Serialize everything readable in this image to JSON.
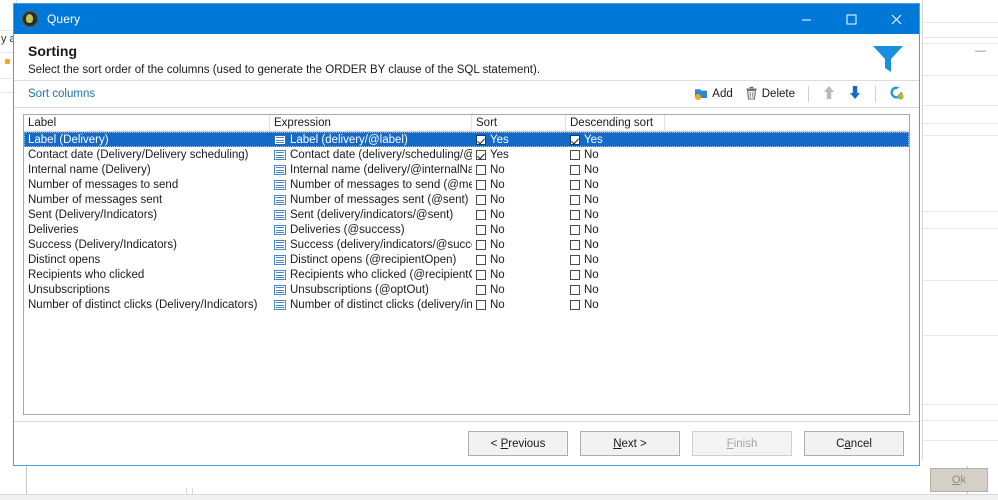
{
  "window": {
    "title": "Query",
    "icon": "query-app-icon",
    "controls": {
      "minimize": "minimize-icon",
      "maximize": "maximize-icon",
      "close": "close-icon"
    }
  },
  "header": {
    "title": "Sorting",
    "subtitle": "Select the sort order of the columns (used to generate the ORDER BY clause of the SQL statement).",
    "icon": "funnel-filter-icon",
    "accent_color": "#1a8fe0"
  },
  "toolbar": {
    "section_label": "Sort columns",
    "add_label": "Add",
    "delete_label": "Delete",
    "move_up_icon": "arrow-up-icon",
    "move_down_icon": "arrow-down-icon",
    "refresh_icon": "refresh-icon"
  },
  "grid": {
    "columns": [
      "Label",
      "Expression",
      "Sort",
      "Descending sort",
      ""
    ],
    "rows": [
      {
        "label": "Label (Delivery)",
        "expression": "Label (delivery/@label)",
        "sort": "Yes",
        "sort_checked": true,
        "descending": "Yes",
        "descending_checked": true,
        "selected": true,
        "warning": false
      },
      {
        "label": "Contact date (Delivery/Delivery scheduling)",
        "expression": "Contact date (delivery/scheduling/@co...",
        "sort": "Yes",
        "sort_checked": true,
        "descending": "No",
        "descending_checked": false,
        "selected": false,
        "warning": false
      },
      {
        "label": "Internal name (Delivery)",
        "expression": "Internal name (delivery/@internalNa...",
        "sort": "No",
        "sort_checked": false,
        "descending": "No",
        "descending_checked": false,
        "selected": false,
        "warning": true
      },
      {
        "label": "Number of messages to send",
        "expression": "Number of messages to send (@mess...",
        "sort": "No",
        "sort_checked": false,
        "descending": "No",
        "descending_checked": false,
        "selected": false,
        "warning": false
      },
      {
        "label": "Number of messages sent",
        "expression": "Number of messages sent (@sent)",
        "sort": "No",
        "sort_checked": false,
        "descending": "No",
        "descending_checked": false,
        "selected": false,
        "warning": false
      },
      {
        "label": "Sent (Delivery/Indicators)",
        "expression": "Sent (delivery/indicators/@sent)",
        "sort": "No",
        "sort_checked": false,
        "descending": "No",
        "descending_checked": false,
        "selected": false,
        "warning": false
      },
      {
        "label": "Deliveries",
        "expression": "Deliveries (@success)",
        "sort": "No",
        "sort_checked": false,
        "descending": "No",
        "descending_checked": false,
        "selected": false,
        "warning": false
      },
      {
        "label": "Success (Delivery/Indicators)",
        "expression": "Success (delivery/indicators/@success)",
        "sort": "No",
        "sort_checked": false,
        "descending": "No",
        "descending_checked": false,
        "selected": false,
        "warning": false
      },
      {
        "label": "Distinct opens",
        "expression": "Distinct opens (@recipientOpen)",
        "sort": "No",
        "sort_checked": false,
        "descending": "No",
        "descending_checked": false,
        "selected": false,
        "warning": false
      },
      {
        "label": "Recipients who clicked",
        "expression": "Recipients who clicked (@recipientClic...",
        "sort": "No",
        "sort_checked": false,
        "descending": "No",
        "descending_checked": false,
        "selected": false,
        "warning": false
      },
      {
        "label": "Unsubscriptions",
        "expression": "Unsubscriptions (@optOut)",
        "sort": "No",
        "sort_checked": false,
        "descending": "No",
        "descending_checked": false,
        "selected": false,
        "warning": false
      },
      {
        "label": "Number of distinct clicks (Delivery/Indicators)",
        "expression": "Number of distinct clicks (delivery/in...",
        "sort": "No",
        "sort_checked": false,
        "descending": "No",
        "descending_checked": false,
        "selected": false,
        "warning": false
      }
    ]
  },
  "footer": {
    "previous": "< Previous",
    "previous_pre": "< ",
    "previous_accel": "P",
    "previous_post": "revious",
    "next_pre": "",
    "next_accel": "N",
    "next_post": "ext >",
    "finish_pre": "",
    "finish_accel": "F",
    "finish_post": "inish",
    "cancel_pre": "C",
    "cancel_accel": "a",
    "cancel_post": "ncel",
    "finish_disabled": true
  },
  "background": {
    "fragment_text": "y a",
    "dash": "—",
    "ok_pre": "O",
    "ok_accel": "O",
    "ok_post": "k",
    "ok_label": "Ok"
  }
}
